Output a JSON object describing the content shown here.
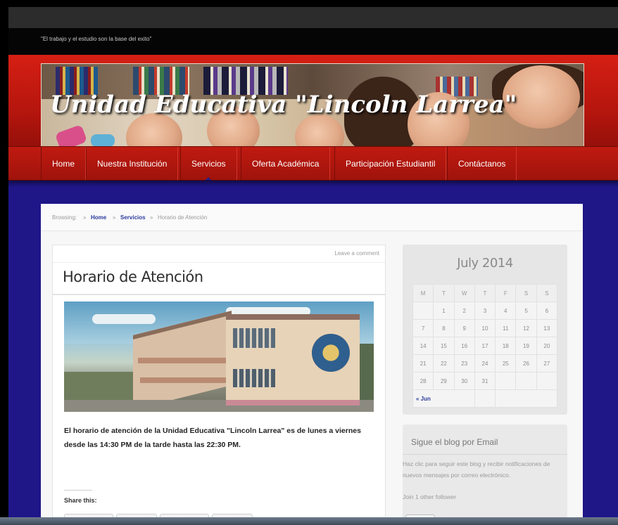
{
  "site": {
    "tagline": "\"El trabajo y el estudio son la base del exito\"",
    "title": "Unidad Educativa \"Lincoln Larrea\""
  },
  "nav": {
    "items": [
      {
        "label": "Home"
      },
      {
        "label": "Nuestra Institución"
      },
      {
        "label": "Servicios"
      },
      {
        "label": "Oferta Académica"
      },
      {
        "label": "Participación Estudiantil"
      },
      {
        "label": "Contáctanos"
      }
    ],
    "active": "Servicios"
  },
  "breadcrumb": {
    "prefix": "Browsing:",
    "sep": "»",
    "home": "Home",
    "section": "Servicios",
    "current": "Horario de Atención"
  },
  "post": {
    "leave_comment": "Leave a comment",
    "title": "Horario de Atención",
    "body": "El horario de atención de la Unidad Educativa \"Lincoln Larrea\" es de lunes a viernes desde las 14:30 PM de la tarde hasta las 22:30 PM.",
    "share_label": "Share this:"
  },
  "calendar": {
    "title": "July 2014",
    "weekdays": [
      "M",
      "T",
      "W",
      "T",
      "F",
      "S",
      "S"
    ],
    "weeks": [
      [
        "",
        "1",
        "2",
        "3",
        "4",
        "5",
        "6"
      ],
      [
        "7",
        "8",
        "9",
        "10",
        "11",
        "12",
        "13"
      ],
      [
        "14",
        "15",
        "16",
        "17",
        "18",
        "19",
        "20"
      ],
      [
        "21",
        "22",
        "23",
        "24",
        "25",
        "26",
        "27"
      ],
      [
        "28",
        "29",
        "30",
        "31",
        "",
        "",
        ""
      ]
    ],
    "prev_link": "« Jun"
  },
  "follow": {
    "title": "Sigue el blog por Email",
    "description": "Haz clic para seguir este blog y recibir notificaciones de nuevos mensajes por correo electrónico.",
    "count": "Join 1 other follower"
  },
  "colors": {
    "header_red": "#c01a10",
    "page_blue": "#1f1688",
    "link_blue": "#2a3b9c"
  }
}
